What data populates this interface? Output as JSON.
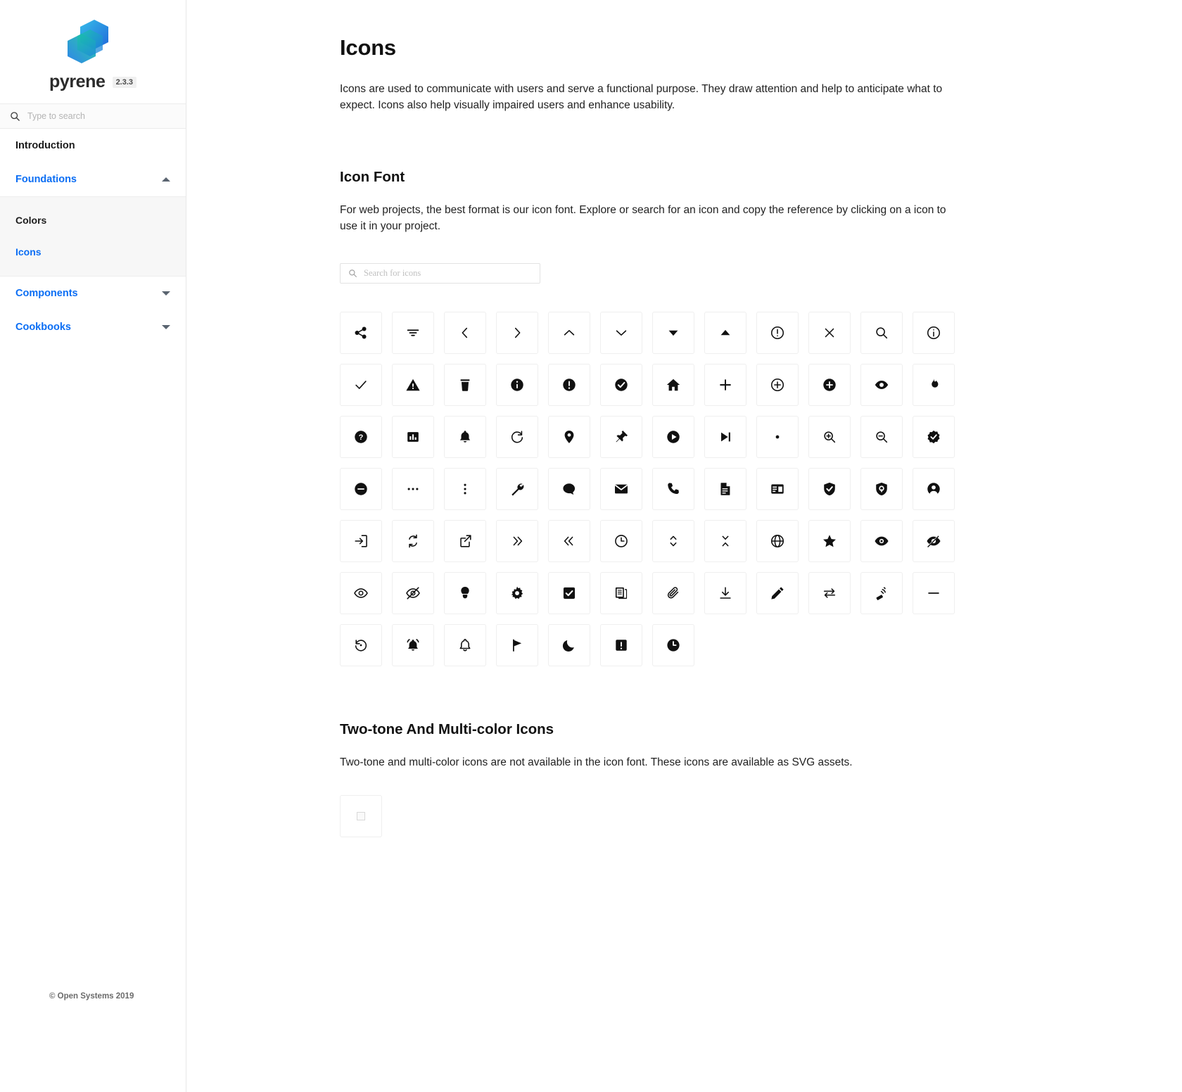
{
  "brand": {
    "name": "pyrene",
    "version": "2.3.3",
    "logo_icon": "pyrene-hexagon-logo",
    "logo_colors": [
      "#1e7ae8",
      "#2bb9e8",
      "#19c9a0",
      "#1560d8"
    ]
  },
  "sidebar": {
    "search": {
      "placeholder": "Type to search",
      "icon": "search-icon"
    },
    "items": [
      {
        "label": "Introduction",
        "style": "plain",
        "caret": ""
      },
      {
        "label": "Foundations",
        "style": "link",
        "caret": "up"
      },
      {
        "label": "Components",
        "style": "link",
        "caret": "down"
      },
      {
        "label": "Cookbooks",
        "style": "link",
        "caret": "down"
      }
    ],
    "subitems": [
      {
        "label": "Colors",
        "active": false
      },
      {
        "label": "Icons",
        "active": true
      }
    ],
    "footer": "© Open Systems 2019"
  },
  "main": {
    "title": "Icons",
    "intro": "Icons are used to communicate with users and serve a functional purpose. They draw attention and help to anticipate what to expect. Icons also help visually impaired users and enhance usability.",
    "icon_font": {
      "heading": "Icon Font",
      "text": "For web projects, the best format is our icon font. Explore or search for an icon and copy the reference by clicking on a icon to use it in your project.",
      "search_placeholder": "Search for icons",
      "search_icon": "search-icon"
    },
    "two_tone": {
      "heading": "Two-tone And Multi-color Icons",
      "text": "Two-tone and multi-color icons are not available in the icon font. These icons are available as SVG assets.",
      "tiles": [
        "svg-asset-placeholder"
      ]
    }
  },
  "colors": {
    "accent": "#0b6ef4",
    "text": "#1c1c1c",
    "muted": "#b4b4b4",
    "tile_border": "#efefef",
    "sidebar_active_bg": "#f7f7f7"
  },
  "icon_grid": {
    "columns": 12,
    "count": 79,
    "names": [
      "share-icon",
      "filter-icon",
      "chevron-left-icon",
      "chevron-right-icon",
      "chevron-up-icon",
      "chevron-down-icon",
      "caret-down-icon",
      "caret-up-icon",
      "alert-circle-icon",
      "close-icon",
      "search-icon",
      "info-circle-icon",
      "check-icon",
      "warning-triangle-icon",
      "trash-icon",
      "info-filled-icon",
      "alert-filled-icon",
      "check-circle-filled-icon",
      "home-icon",
      "plus-icon",
      "plus-circle-outline-icon",
      "plus-circle-filled-icon",
      "eye-filled-icon",
      "fire-icon",
      "help-circle-icon",
      "chart-bar-icon",
      "bell-filled-icon",
      "refresh-icon",
      "location-pin-icon",
      "pin-icon",
      "play-circle-icon",
      "skip-forward-icon",
      "dot-icon",
      "zoom-in-icon",
      "zoom-out-icon",
      "badge-check-icon",
      "minus-circle-icon",
      "more-horizontal-icon",
      "more-vertical-icon",
      "wrench-icon",
      "chat-bubble-icon",
      "mail-icon",
      "phone-icon",
      "document-icon",
      "credit-card-icon",
      "shield-check-icon",
      "shield-lock-icon",
      "user-circle-icon",
      "login-icon",
      "sync-icon",
      "external-link-icon",
      "chevrons-right-icon",
      "chevrons-left-icon",
      "clock-icon",
      "expand-vertical-icon",
      "collapse-vertical-icon",
      "globe-icon",
      "star-icon",
      "eye-bold-icon",
      "eye-off-bold-icon",
      "eye-outline-icon",
      "eye-off-outline-icon",
      "lightbulb-icon",
      "gear-icon",
      "checkbox-checked-icon",
      "copy-icon",
      "paperclip-icon",
      "download-icon",
      "pencil-icon",
      "transfer-icon",
      "antenna-icon",
      "minus-icon",
      "history-icon",
      "bell-ring-icon",
      "bell-outline-icon",
      "flag-icon",
      "moon-icon",
      "alert-square-icon",
      "clock-filled-icon"
    ]
  }
}
